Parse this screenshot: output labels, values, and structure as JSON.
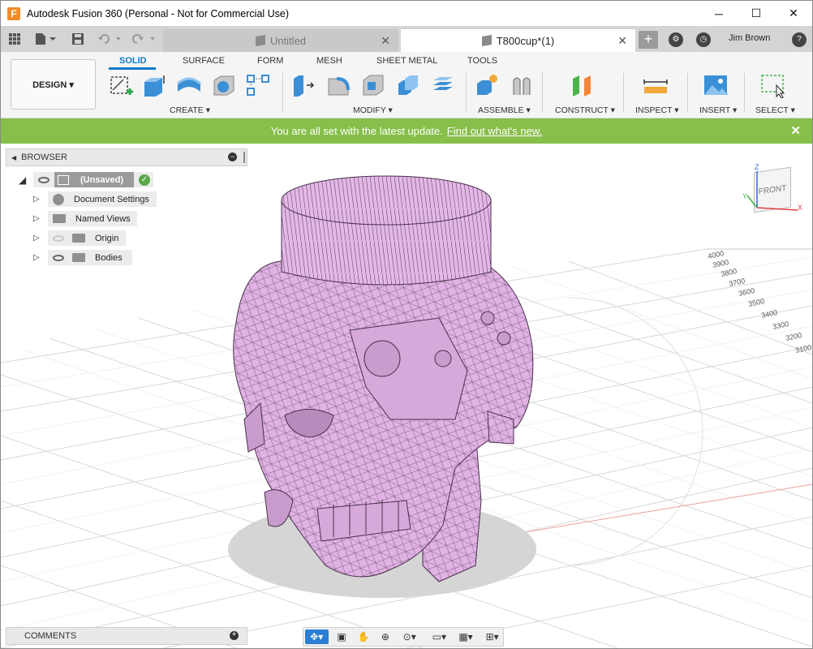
{
  "titlebar": {
    "title": "Autodesk Fusion 360 (Personal - Not for Commercial Use)",
    "logo_letter": "F",
    "minimize": "─",
    "maximize": "☐",
    "close": "✕"
  },
  "tabs": {
    "items": [
      {
        "label": "Untitled",
        "active": false
      },
      {
        "label": "T800cup*(1)",
        "active": true
      }
    ],
    "close_glyph": "✕",
    "new_tab_glyph": "+",
    "user_name": "Jim Brown",
    "help_glyph": "?"
  },
  "toolbar": {
    "workspace": "DESIGN ▾",
    "workspace_tabs": [
      "SOLID",
      "SURFACE",
      "FORM",
      "MESH",
      "SHEET METAL",
      "TOOLS"
    ],
    "groups": [
      "CREATE ▾",
      "MODIFY ▾",
      "ASSEMBLE ▾",
      "CONSTRUCT ▾",
      "INSPECT ▾",
      "INSERT ▾",
      "SELECT ▾"
    ]
  },
  "update_bar": {
    "message": "You are all set with the latest update.",
    "link": "Find out what's new.",
    "close_glyph": "✕"
  },
  "browser": {
    "title": "BROWSER",
    "root": "(Unsaved)",
    "items": [
      "Document Settings",
      "Named Views",
      "Origin",
      "Bodies"
    ]
  },
  "comments": {
    "title": "COMMENTS"
  },
  "viewcube": {
    "label": "FRONT"
  },
  "grid_labels": [
    "4000",
    "3900",
    "3800",
    "3700",
    "3600",
    "3500",
    "3400",
    "3300",
    "3200",
    "3100"
  ],
  "icons": {
    "model_color": "#e3b8e6",
    "mesh_line": "#5a3c5d",
    "update_bar_color": "#87bf4a",
    "accent": "#0a7ac7"
  }
}
